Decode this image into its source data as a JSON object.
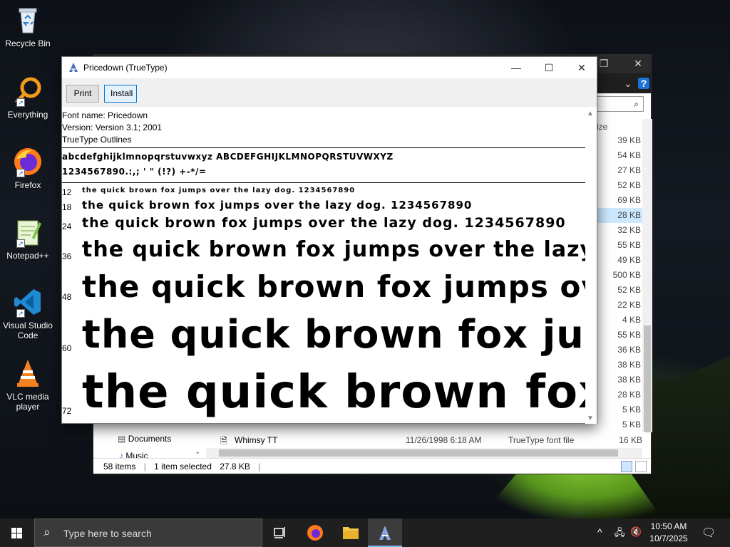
{
  "desktop": {
    "icons": [
      {
        "label": "Recycle Bin",
        "icon": "recycle-bin-icon"
      },
      {
        "label": "Everything",
        "icon": "everything-icon"
      },
      {
        "label": "Firefox",
        "icon": "firefox-icon"
      },
      {
        "label": "Notepad++",
        "icon": "notepad-plus-plus-icon"
      },
      {
        "label": "Visual Studio Code",
        "icon": "vscode-icon"
      },
      {
        "label": "VLC media player",
        "icon": "vlc-icon"
      }
    ]
  },
  "explorer": {
    "size_header": "ize",
    "sizes": [
      "39 KB",
      "54 KB",
      "27 KB",
      "52 KB",
      "69 KB",
      "28 KB",
      "32 KB",
      "55 KB",
      "49 KB",
      "500 KB",
      "52 KB",
      "22 KB",
      "4 KB",
      "55 KB",
      "36 KB",
      "38 KB",
      "38 KB",
      "28 KB",
      "5 KB",
      "5 KB"
    ],
    "selected_index": 5,
    "nav": {
      "documents": "Documents",
      "music": "Music"
    },
    "last_row": {
      "name": "Whimsy TT",
      "date": "11/26/1998 6:18 AM",
      "type": "TrueType font file",
      "size": "16 KB"
    },
    "status": {
      "items": "58 items",
      "selected": "1 item selected",
      "size": "27.8 KB"
    }
  },
  "fontviewer": {
    "title": "Pricedown (TrueType)",
    "buttons": {
      "print": "Print",
      "install": "Install"
    },
    "meta": {
      "name": "Font name: Pricedown",
      "version": "Version: Version 3.1; 2001",
      "outlines": "TrueType Outlines"
    },
    "charset_line1": "abcdefghijklmnopqrstuvwxyz ABCDEFGHIJKLMNOPQRSTUVWXYZ",
    "charset_line2": "1234567890.:,; ' \" (!?) +-*/=",
    "samples": [
      {
        "size": "12",
        "text": "the quick brown fox jumps over the lazy dog. 1234567890"
      },
      {
        "size": "18",
        "text": "the quick brown fox jumps over the lazy dog. 1234567890"
      },
      {
        "size": "24",
        "text": "the quick brown fox jumps over the lazy dog. 1234567890"
      },
      {
        "size": "36",
        "text": "the quick brown fox jumps over the lazy"
      },
      {
        "size": "48",
        "text": "the quick brown fox jumps over"
      },
      {
        "size": "60",
        "text": "the quick brown fox jum"
      },
      {
        "size": "72",
        "text": "the quick brown fox"
      }
    ]
  },
  "taskbar": {
    "search_placeholder": "Type here to search",
    "time": "10:50 AM",
    "date": "10/7/2025"
  }
}
